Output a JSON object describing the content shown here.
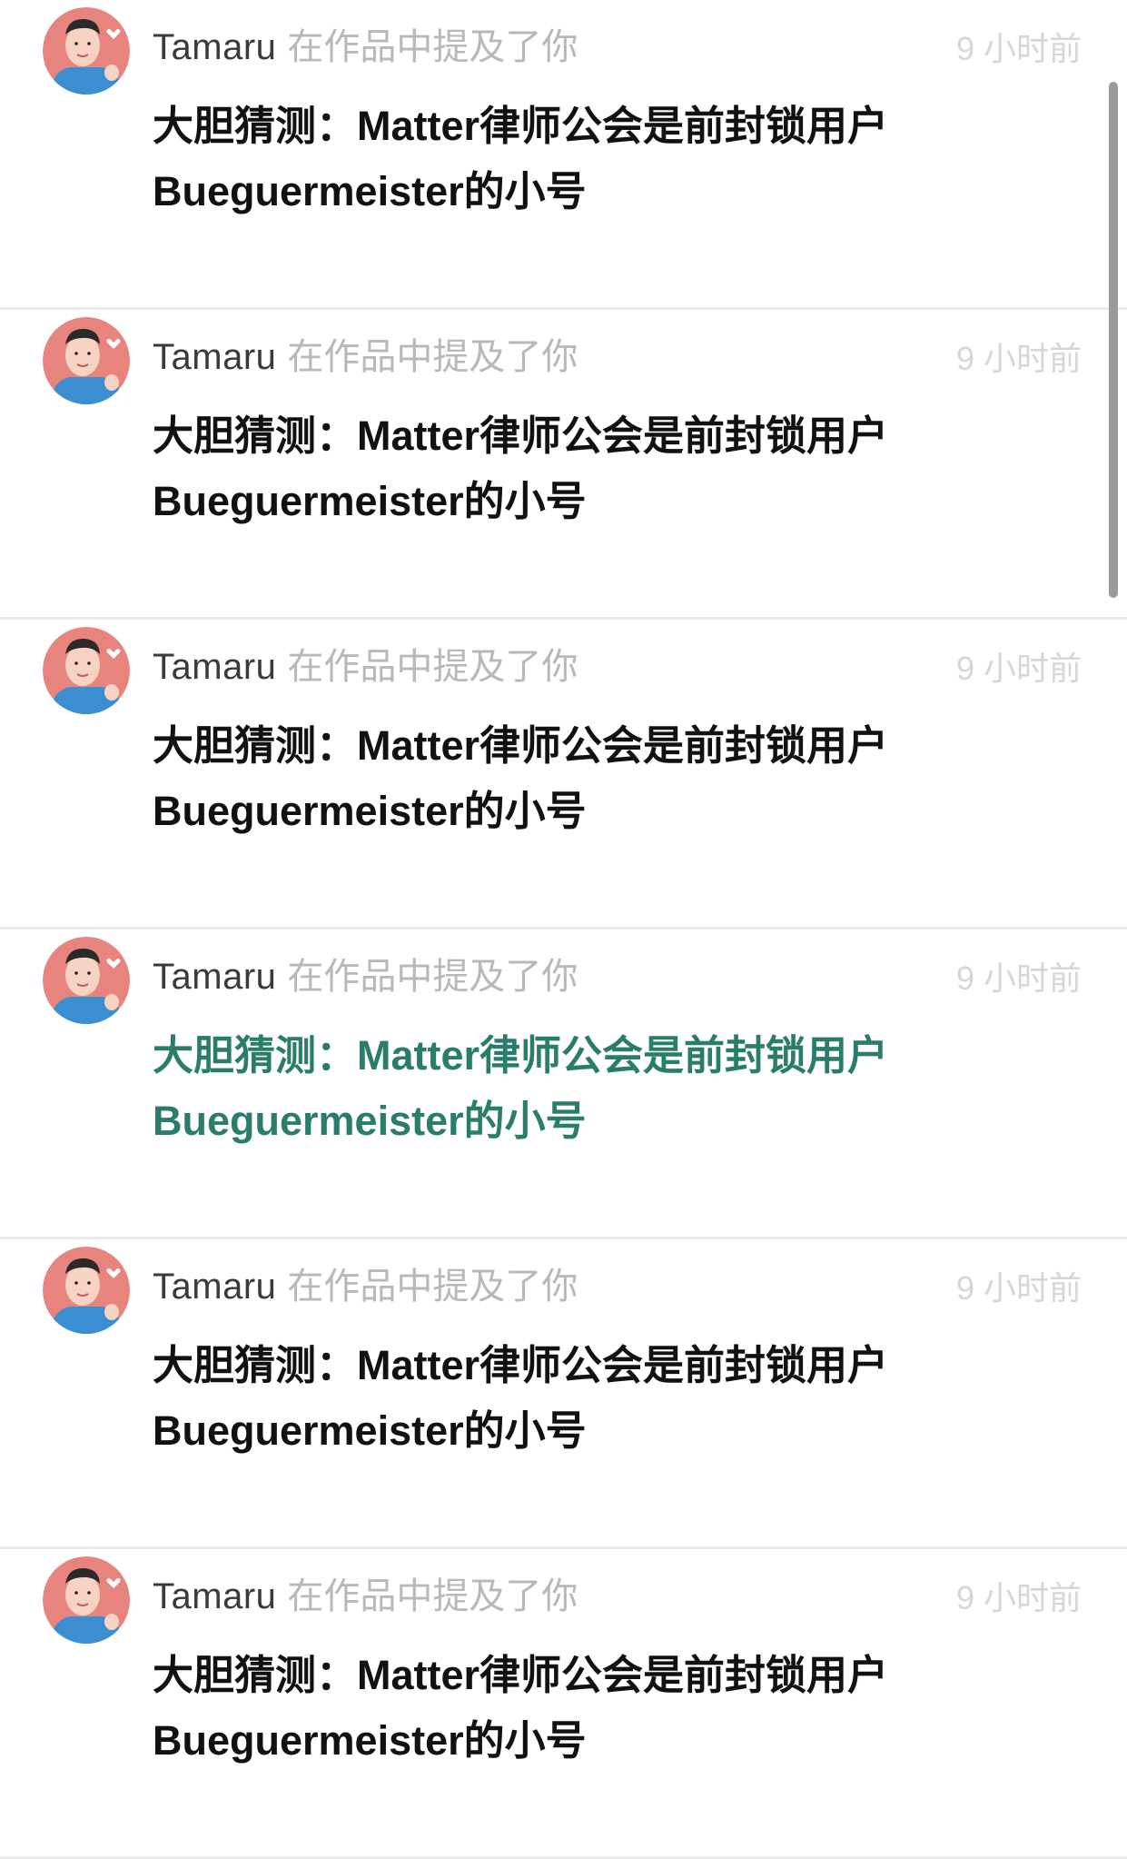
{
  "notifications": [
    {
      "username": "Tamaru",
      "action": "在作品中提及了你",
      "time": "9 小时前",
      "title_line1": "大胆猜测：Matter律师公会是前封锁用户",
      "title_line2": "Bueguermeister的小号",
      "avatar_icon": "cartoon-man-avatar-icon"
    },
    {
      "username": "Tamaru",
      "action": "在作品中提及了你",
      "time": "9 小时前",
      "title_line1": "大胆猜测：Matter律师公会是前封锁用户",
      "title_line2": "Bueguermeister的小号",
      "avatar_icon": "cartoon-man-avatar-icon"
    },
    {
      "username": "Tamaru",
      "action": "在作品中提及了你",
      "time": "9 小时前",
      "title_line1": "大胆猜测：Matter律师公会是前封锁用户",
      "title_line2": "Bueguermeister的小号",
      "avatar_icon": "cartoon-man-avatar-icon"
    },
    {
      "username": "Tamaru",
      "action": "在作品中提及了你",
      "time": "9 小时前",
      "title_line1": "大胆猜测：Matter律师公会是前封锁用户",
      "title_line2": "Bueguermeister的小号",
      "avatar_icon": "cartoon-man-avatar-icon",
      "visited": true
    },
    {
      "username": "Tamaru",
      "action": "在作品中提及了你",
      "time": "9 小时前",
      "title_line1": "大胆猜测：Matter律师公会是前封锁用户",
      "title_line2": "Bueguermeister的小号",
      "avatar_icon": "cartoon-man-avatar-icon"
    },
    {
      "username": "Tamaru",
      "action": "在作品中提及了你",
      "time": "9 小时前",
      "title_line1": "大胆猜测：Matter律师公会是前封锁用户",
      "title_line2": "Bueguermeister的小号",
      "avatar_icon": "cartoon-man-avatar-icon"
    }
  ],
  "colors": {
    "username": "#3a3a3a",
    "action": "#b8b8b8",
    "time": "#d6d6d6",
    "title": "#111111",
    "title_visited": "#2a7d6a",
    "avatar_bg": "#e8847e",
    "avatar_shirt": "#3b8fd0"
  }
}
